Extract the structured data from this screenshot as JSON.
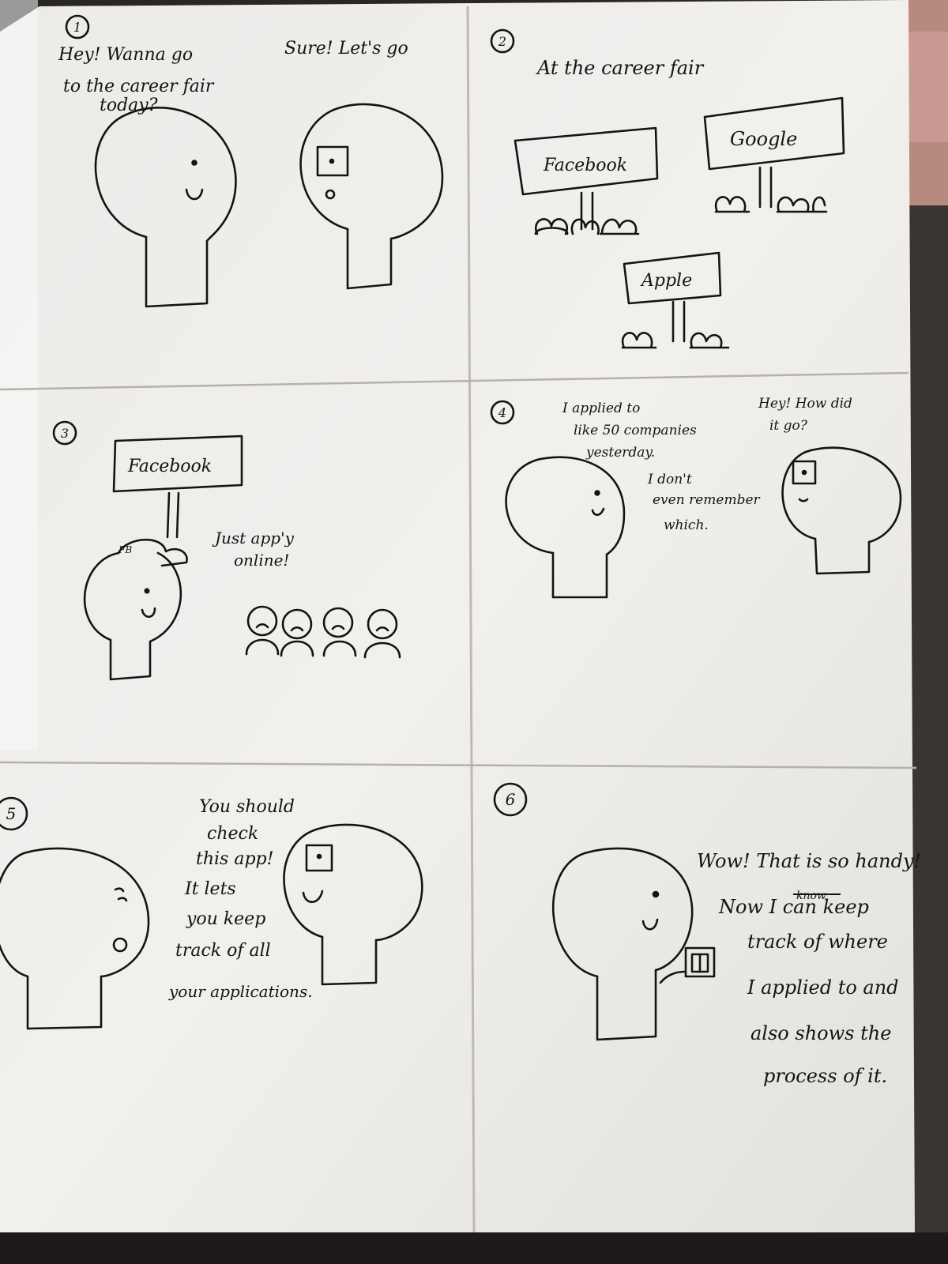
{
  "panel_numbers": [
    "1",
    "2",
    "3",
    "4",
    "5",
    "6"
  ],
  "panel1": {
    "speech_left": [
      "Hey! Wanna go",
      "to the career fair",
      "today?"
    ],
    "speech_right": "Sure! Let's go"
  },
  "panel2": {
    "caption": "At the career fair",
    "booths": [
      "Facebook",
      "Google",
      "Apple"
    ]
  },
  "panel3": {
    "booth": "Facebook",
    "cap_label": "FB",
    "speech": [
      "Just app'y",
      "online!"
    ]
  },
  "panel4": {
    "speech_left": [
      "I applied to",
      "like 50 companies",
      "yesterday.",
      "I don't",
      "even remember",
      "which."
    ],
    "speech_right": [
      "Hey! How did",
      "it go?"
    ]
  },
  "panel5": {
    "speech": [
      "You should",
      "check",
      "this app!",
      "It lets",
      "you keep",
      "track of all",
      "your applications."
    ]
  },
  "panel6": {
    "speech": [
      "Wow! That is so handy!",
      "Now I can keep",
      "track of where",
      "I applied to and",
      "also shows the",
      "process of it."
    ],
    "struck_word": "know"
  },
  "colors": {
    "paper": "#f1efec",
    "ink": "#141414",
    "background": "#2a2624",
    "pink": "#c99a92"
  }
}
